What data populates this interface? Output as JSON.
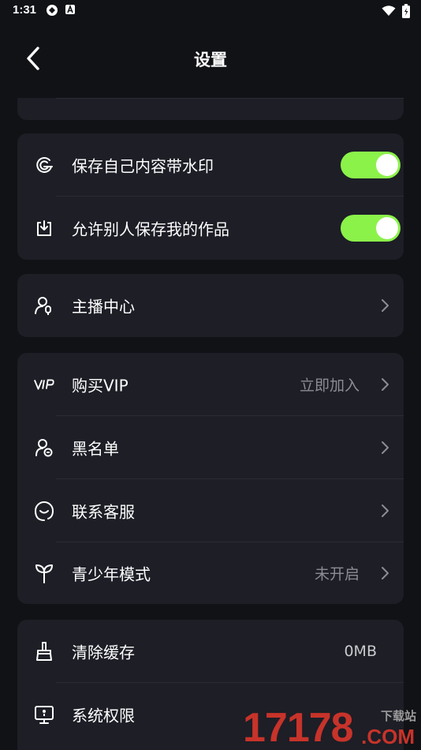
{
  "status_bar": {
    "time": "1:31"
  },
  "header": {
    "title": "设置"
  },
  "watermark_group": {
    "rows": [
      {
        "label": "保存自己内容带水印",
        "icon": "watermark-icon",
        "toggle": true
      },
      {
        "label": "允许别人保存我的作品",
        "icon": "download-icon",
        "toggle": true
      }
    ]
  },
  "host_group": {
    "rows": [
      {
        "label": "主播中心",
        "icon": "host-icon"
      }
    ]
  },
  "account_group": {
    "rows": [
      {
        "label": "购买VIP",
        "value": "立即加入",
        "icon": "vip-icon"
      },
      {
        "label": "黑名单",
        "icon": "blacklist-icon"
      },
      {
        "label": "联系客服",
        "icon": "support-icon"
      },
      {
        "label": "青少年模式",
        "value": "未开启",
        "icon": "sprout-icon"
      }
    ]
  },
  "system_group": {
    "rows": [
      {
        "label": "清除缓存",
        "value": "0MB",
        "icon": "broom-icon"
      },
      {
        "label": "系统权限",
        "icon": "screen-icon"
      }
    ]
  },
  "watermark_overlay": {
    "number": "17178",
    "text": "下载站",
    "domain": ".COM"
  },
  "colors": {
    "background": "#111216",
    "card": "#1d1e26",
    "toggle_on": "#8bf24a",
    "secondary_text": "#8c8d93"
  }
}
